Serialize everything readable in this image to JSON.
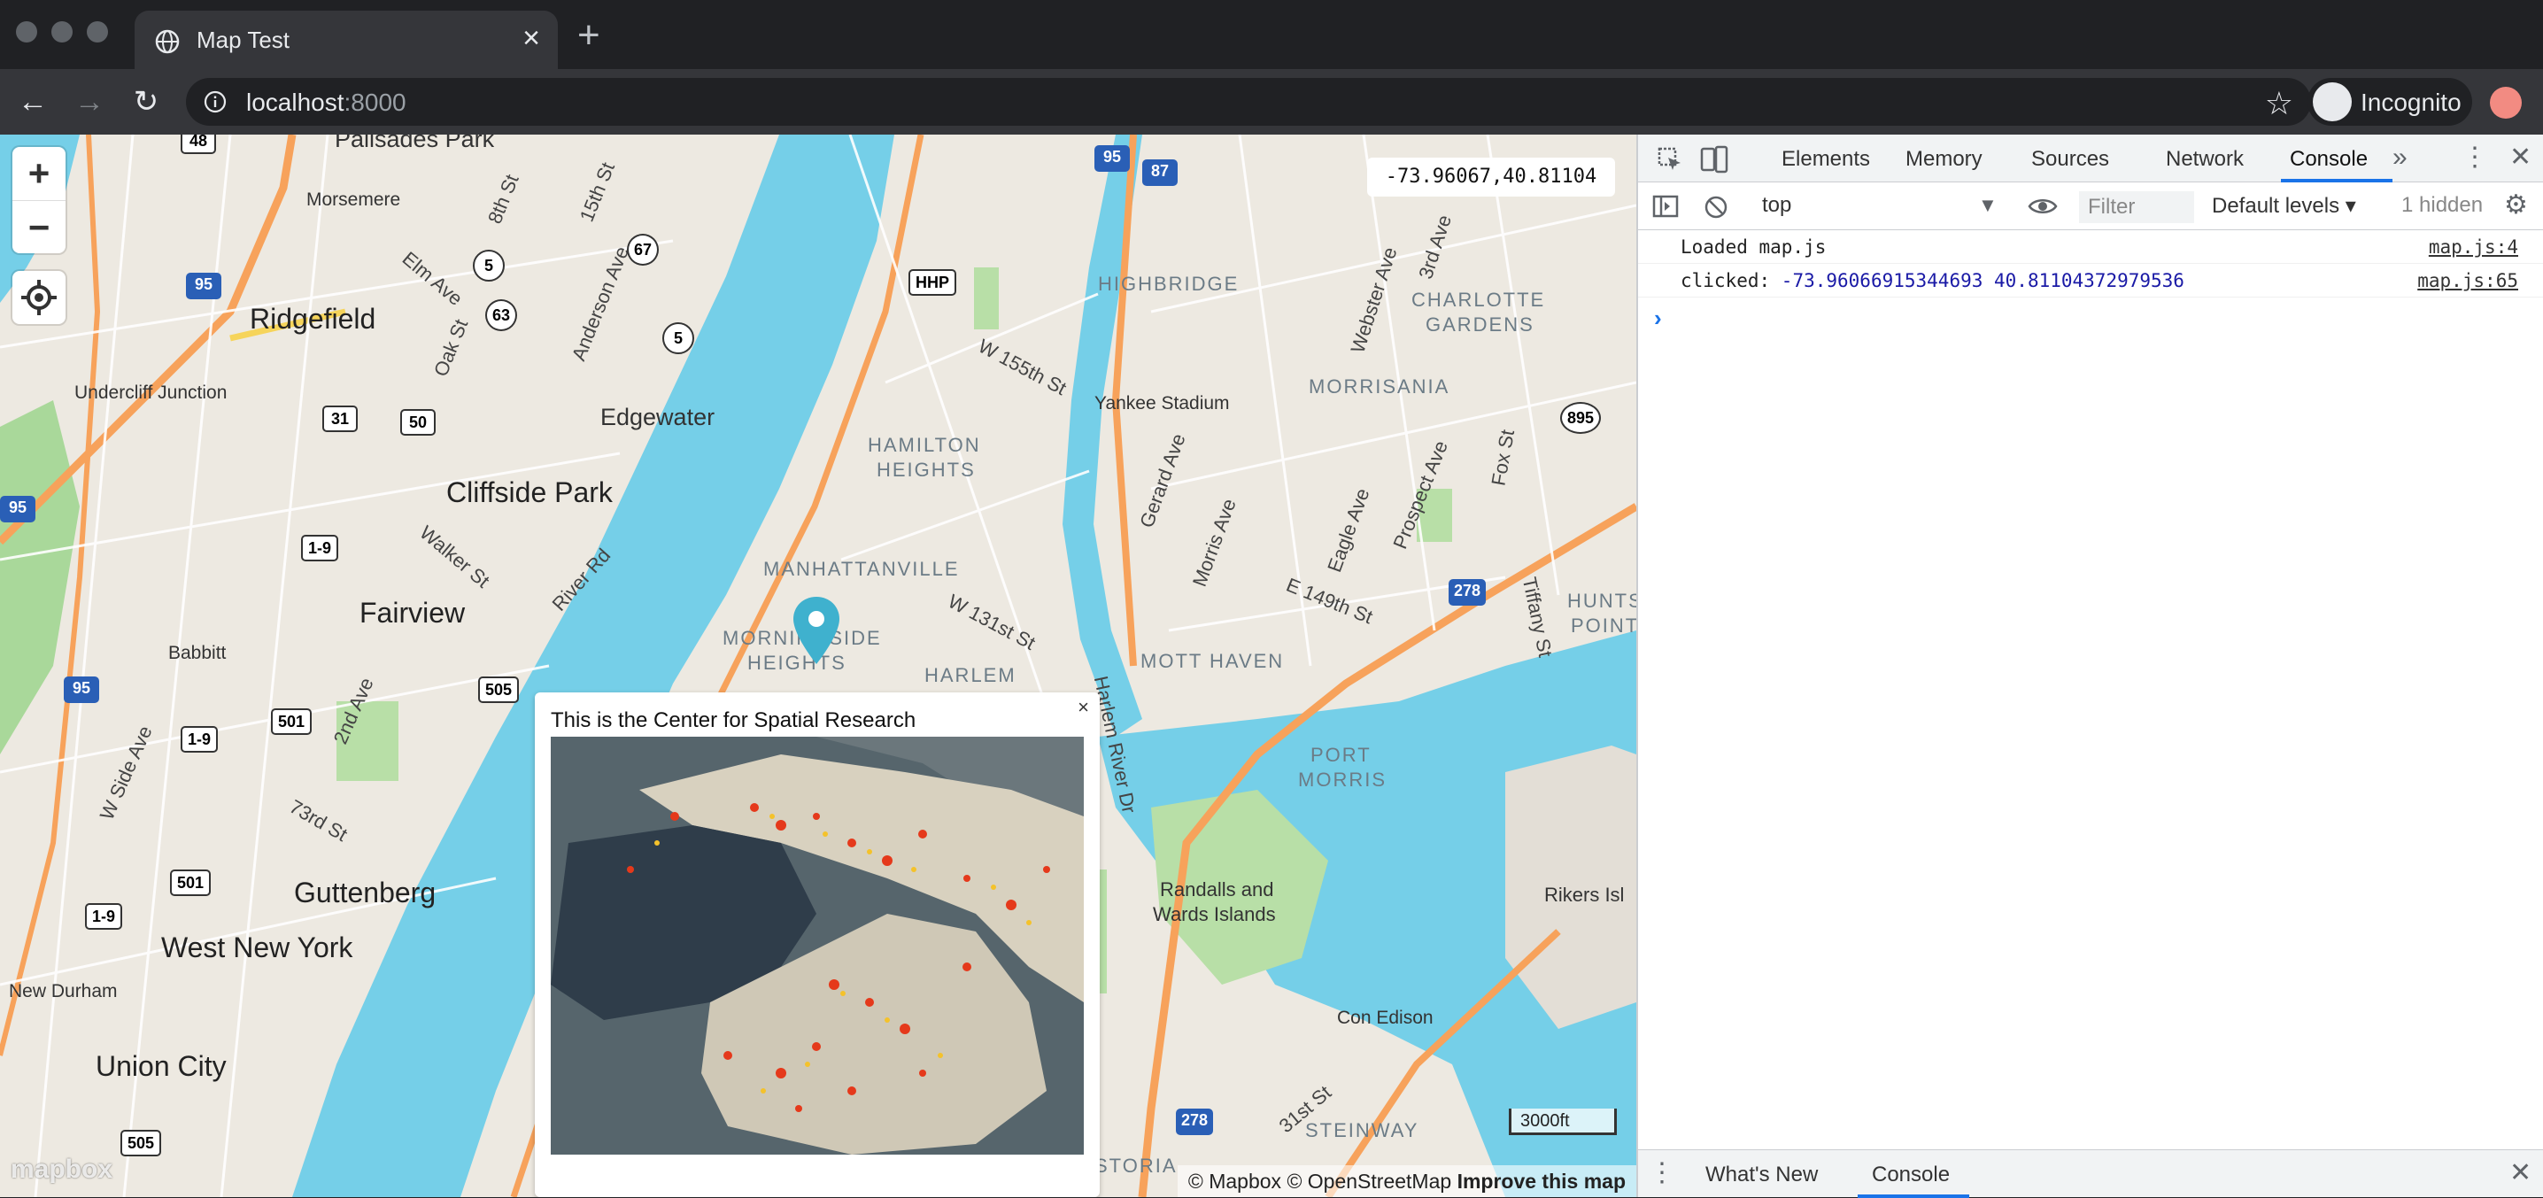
{
  "browser": {
    "tab_title": "Map Test",
    "url_host": "localhost",
    "url_port": ":8000",
    "profile_label": "Incognito"
  },
  "map": {
    "coordinate_readout": "-73.96067,40.81104",
    "popup": {
      "title": "This is the Center for Spatial Research",
      "close_label": "×"
    },
    "scale_label": "3000ft",
    "attribution": {
      "mapbox": "© Mapbox",
      "osm": "© OpenStreetMap",
      "improve": "Improve this map"
    },
    "logo": "mapbox",
    "controls": {
      "zoom_in": "+",
      "zoom_out": "−"
    },
    "labels": {
      "cities": [
        "Ridgefield",
        "Cliffside Park",
        "Fairview",
        "Guttenberg",
        "West New York",
        "Union City",
        "Edgewater",
        "Palisades Park"
      ],
      "places": [
        "Undercliff Junction",
        "Morsemere",
        "Babbitt",
        "New Durham",
        "Con Edison",
        "Yankee Stadium",
        "Rikers Isl",
        "Randalls and",
        "Wards Islands"
      ],
      "neighborhoods": [
        "HAMILTON",
        "HEIGHTS",
        "MANHATTANVILLE",
        "MORNINGSIDE",
        "HEIGHTS",
        "HARLEM",
        "HIGHBRIDGE",
        "MORRISANIA",
        "CHARLOTTE",
        "GARDENS",
        "MOTT HAVEN",
        "PORT",
        "MORRIS",
        "HUNTS",
        "POINT",
        "STEINWAY",
        "STORIA"
      ],
      "streets": [
        "W 155th St",
        "W 131st St",
        "Harlem River Dr",
        "Gerard Ave",
        "Morris Ave",
        "Eagle Ave",
        "Prospect Ave",
        "E 149th St",
        "Tiffany St",
        "Fox St",
        "Webster Ave",
        "3rd Ave",
        "Anderson Ave",
        "Elm Ave",
        "Oak St",
        "Walker St",
        "River Rd",
        "2nd Ave",
        "73rd St",
        "W Side Ave",
        "8th St",
        "15th St",
        "31st St"
      ],
      "shields": [
        "95",
        "87",
        "HHP",
        "95",
        "5",
        "63",
        "67",
        "5",
        "31",
        "50",
        "1-9",
        "501",
        "1-9",
        "505",
        "895",
        "278",
        "95",
        "95",
        "501",
        "1-9",
        "505",
        "278",
        "48"
      ]
    }
  },
  "devtools": {
    "tabs": [
      "Elements",
      "Memory",
      "Sources",
      "Network",
      "Console"
    ],
    "more": "»",
    "context": "top",
    "filter_placeholder": "Filter",
    "levels": "Default levels ▾",
    "hidden": "1 hidden",
    "logs": [
      {
        "prefix": "Loaded map.js",
        "numbers": "",
        "source": "map.js:4"
      },
      {
        "prefix": "clicked: ",
        "numbers": "-73.96066915344693 40.81104372979536",
        "source": "map.js:65"
      }
    ],
    "prompt": "›",
    "drawer_tabs": [
      "What's New",
      "Console"
    ]
  }
}
